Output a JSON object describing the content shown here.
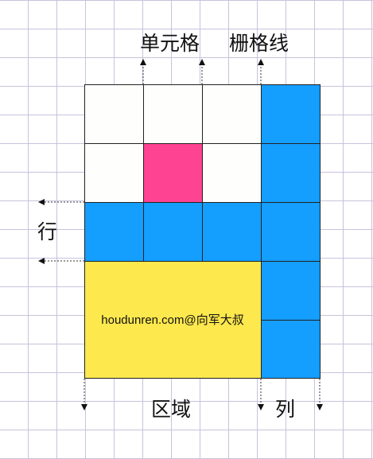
{
  "labels": {
    "cell": "单元格",
    "grid_line": "栅格线",
    "row": "行",
    "area": "区域",
    "column": "列"
  },
  "watermark": "houdunren.com@向军大叔",
  "colors": {
    "blue": "#149efd",
    "pink": "#fe4392",
    "yellow": "#fde84d",
    "white": "#fefefc"
  }
}
